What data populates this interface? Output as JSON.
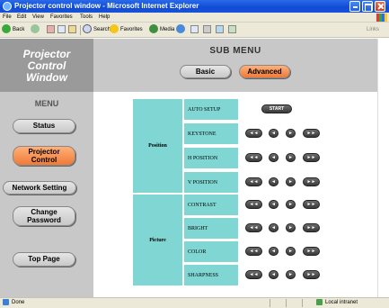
{
  "window": {
    "title": "Projector control window - Microsoft Internet Explorer"
  },
  "menubar": {
    "items": [
      "File",
      "Edit",
      "View",
      "Favorites",
      "Tools",
      "Help"
    ]
  },
  "toolbar": {
    "back": "Back",
    "search": "Search",
    "favorites": "Favorites",
    "media": "Media",
    "links": "Links"
  },
  "logo": {
    "line1": "Projector",
    "line2": "Control",
    "line3": "Window"
  },
  "submenu": {
    "title": "SUB MENU",
    "basic": "Basic",
    "advanced": "Advanced"
  },
  "sidebar": {
    "heading": "MENU",
    "status": "Status",
    "projector_control_line1": "Projector",
    "projector_control_line2": "Control",
    "network_setting": "Network Setting",
    "change_password_line1": "Change",
    "change_password_line2": "Password",
    "top_page": "Top Page"
  },
  "controls": {
    "position_label": "Position",
    "picture_label": "Picture",
    "start": "START",
    "items": {
      "auto_setup": "AUTO SETUP",
      "keystone": "KEYSTONE",
      "h_position": "H POSITION",
      "v_position": "V POSITION",
      "contrast": "CONTRAST",
      "bright": "BRIGHT",
      "color": "COLOR",
      "sharpness": "SHARPNESS"
    },
    "glyph_fast_left": "◄◄",
    "glyph_left": "◄",
    "glyph_right": "►",
    "glyph_fast_right": "►►"
  },
  "statusbar": {
    "left": "Done",
    "right": "Local intranet"
  },
  "colors": {
    "titlebar": "#0f4bd6",
    "panel_gray": "#c8c8c8",
    "accent_orange": "#f07a36",
    "cell_teal": "#7fd6d3",
    "button_dark": "#3a3a3a"
  }
}
